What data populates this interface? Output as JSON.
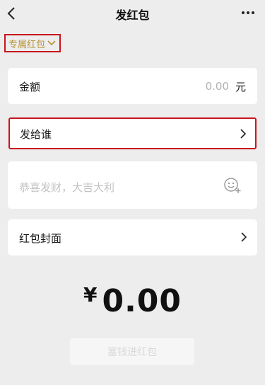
{
  "header": {
    "title": "发红包",
    "back_icon": "chevron-left-icon",
    "more_icon": "more-dots-icon"
  },
  "packet_type": {
    "label": "专属红包",
    "icon": "chevron-down-icon",
    "color": "#b9913a"
  },
  "amount": {
    "label": "金额",
    "value": "0.00",
    "unit": "元"
  },
  "recipient": {
    "label": "发给谁",
    "icon": "chevron-right-icon"
  },
  "greeting": {
    "placeholder": "恭喜发财，大吉大利",
    "icon": "emoji-add-icon"
  },
  "cover": {
    "label": "红包封面",
    "icon": "chevron-right-icon"
  },
  "total": {
    "currency": "¥",
    "amount": "0.00"
  },
  "submit": {
    "label": "塞钱进红包"
  },
  "colors": {
    "highlight_border": "#c8161d",
    "background": "#ededed"
  }
}
